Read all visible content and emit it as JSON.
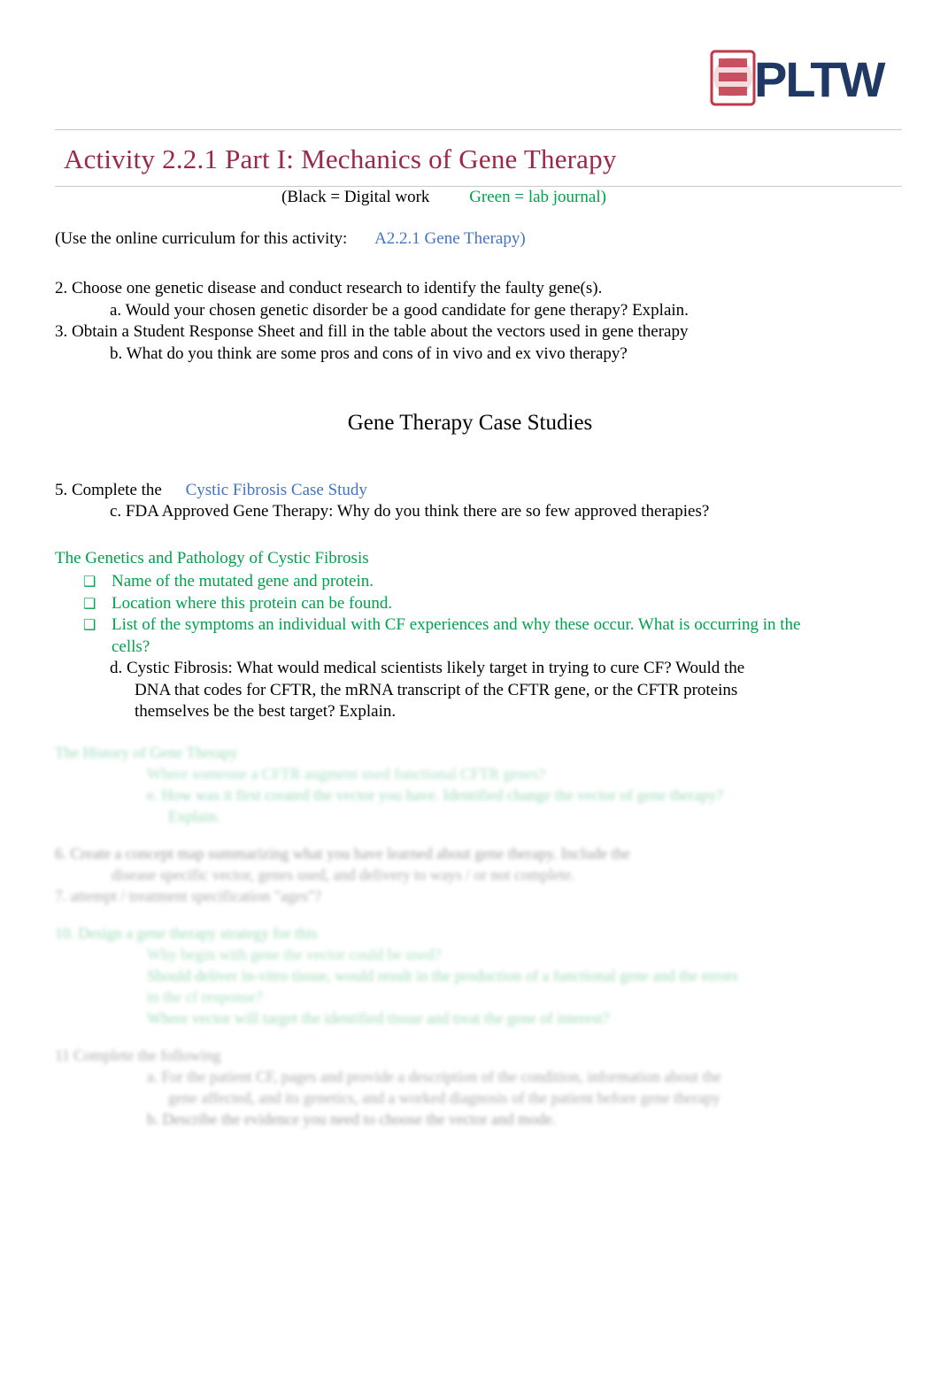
{
  "logo": {
    "text": "PLTW",
    "mark": "pltw-shield-icon"
  },
  "title": "Activity 2.2.1 Part I: Mechanics of Gene Therapy",
  "key_line": {
    "black": "(Black = Digital work",
    "green": "Green = lab journal)"
  },
  "curriculum": {
    "label": "(Use the online curriculum for this activity:",
    "link": "A2.2.1 Gene Therapy)"
  },
  "questions": {
    "q2": "2. Choose one genetic disease and conduct research to identify the faulty gene(s).",
    "q2a": "a. Would your chosen genetic disorder be a good candidate for gene therapy? Explain.",
    "q3": "3. Obtain a Student Response Sheet and fill in the table about the vectors used in gene therapy",
    "q3b": "b. What do you think are some pros and cons of in vivo and ex vivo therapy?"
  },
  "section_heading": "Gene Therapy Case Studies",
  "item5": {
    "label": "5.  Complete  the",
    "link": "Cystic Fibrosis Case Study",
    "sub_c": "c.   FDA Approved Gene Therapy: Why do you think there are so few approved therapies?"
  },
  "green_section": {
    "heading": "The Genetics and Pathology of Cystic Fibrosis",
    "bullet_glyph": "❑",
    "items": [
      "Name of the mutated gene and protein.",
      "Location where this protein can be found.",
      "List of the symptoms an individual with CF experiences and why these occur. What is occurring in the cells?"
    ]
  },
  "item_d": {
    "line1": "d. Cystic Fibrosis: What would medical scientists likely target in trying to cure CF? Would the",
    "line2": "DNA that codes for CFTR, the mRNA transcript of the CFTR gene, or the CFTR proteins",
    "line3": "themselves be the best target? Explain."
  },
  "faded_block": {
    "h1": "The History of Gene Therapy",
    "l1": "Where someone a CFTR augment used functional CFTR genes?",
    "l2": "e. How was it first created the vector you have. Identified change the vector of gene therapy?",
    "l3": "Explain.",
    "l4": "6. Create a concept map summarizing what you have learned about gene therapy. Include the",
    "l5": "disease specific vector, genes used, and delivery to ways / or not complete.",
    "l6": "7. attempt / treatment specification \"ages\"?",
    "h2": "10. Design a gene therapy strategy for this",
    "l7": "Why begin with gene the vector could be used?",
    "l8": "Should deliver in-vitro tissue, would result in the production of a functional gene and the errors",
    "l9": "in the cf response?",
    "l10": "Where vector will target the identified tissue and treat the gene of interest?",
    "h3": "11 Complete the following",
    "l11": "a. For the patient CF, pages and provide a description of the condition, information about the",
    "l12": "gene affected, and its genetics, and a worked diagnosis of the patient before gene therapy",
    "l13": "b.   Describe the evidence you need to choose the vector and mode."
  }
}
